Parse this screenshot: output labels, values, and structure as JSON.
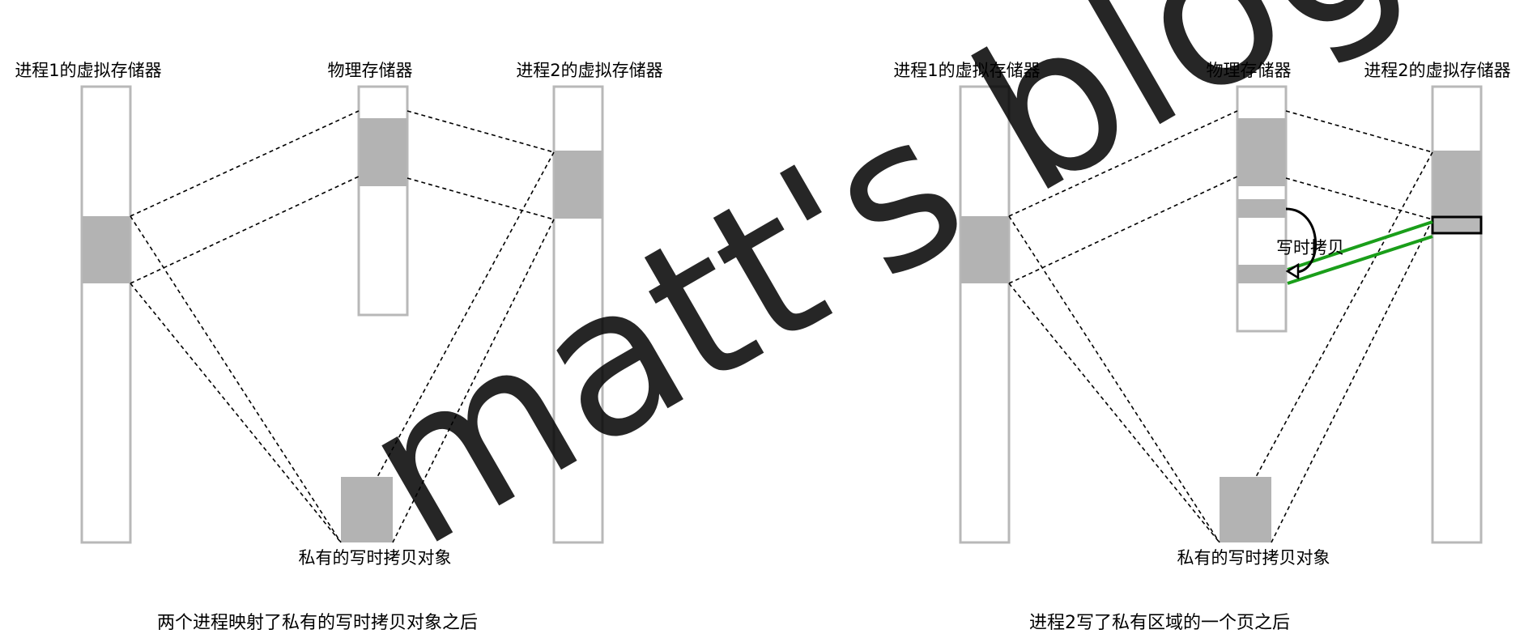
{
  "left_panel": {
    "proc1_label": "进程1的虚拟存储器",
    "phys_label": "物理存储器",
    "proc2_label": "进程2的虚拟存储器",
    "object_label": "私有的写时拷贝对象",
    "caption": "两个进程映射了私有的写时拷贝对象之后"
  },
  "right_panel": {
    "proc1_label": "进程1的虚拟存储器",
    "phys_label": "物理存储器",
    "proc2_label": "进程2的虚拟存储器",
    "object_label": "私有的写时拷贝对象",
    "cow_label": "写时拷贝",
    "caption": "进程2写了私有区域的一个页之后"
  },
  "watermark": "matt's blog",
  "colors": {
    "column_border": "#b8b8b8",
    "region_fill": "#b3b3b3",
    "green_arrow": "#1a9e1a",
    "watermark": "#c8ffc8"
  }
}
